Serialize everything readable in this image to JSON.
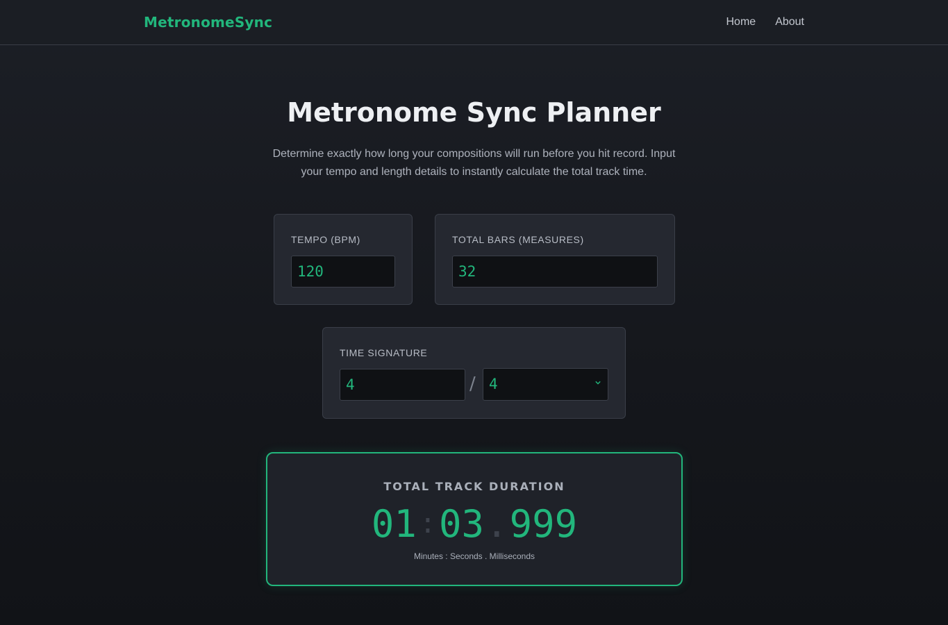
{
  "nav": {
    "brand": "MetronomeSync",
    "links": [
      "Home",
      "About"
    ]
  },
  "hero": {
    "title": "Metronome Sync Planner",
    "subtitle": "Determine exactly how long your compositions will run before you hit record. Input your tempo and length details to instantly calculate the total track time."
  },
  "tempo": {
    "label": "Tempo (BPM)",
    "value": "120"
  },
  "bars": {
    "label": "Total Bars (Measures)",
    "value": "32"
  },
  "time_signature": {
    "label": "Time Signature",
    "beats": "4",
    "separator": "/",
    "note_value": "4"
  },
  "result": {
    "title": "TOTAL TRACK DURATION",
    "minutes": "01",
    "seconds": "03",
    "milliseconds": "999",
    "colon": ":",
    "dot": ".",
    "caption": "Minutes : Seconds . Milliseconds"
  },
  "colors": {
    "accent": "#22b67c",
    "background": "#1c1f26",
    "card": "#252830"
  }
}
